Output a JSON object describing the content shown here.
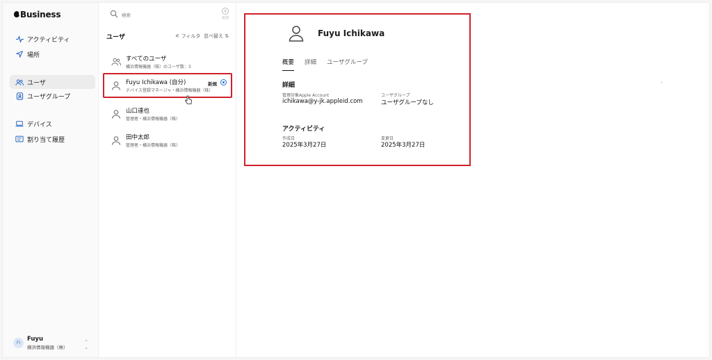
{
  "app": {
    "brand": "Business"
  },
  "sidebar": {
    "items": [
      {
        "label": "アクティビティ",
        "icon": "activity-icon"
      },
      {
        "label": "場所",
        "icon": "location-arrow-icon"
      },
      {
        "label": "ユーザ",
        "icon": "users-icon",
        "active": true
      },
      {
        "label": "ユーザグループ",
        "icon": "user-group-icon"
      },
      {
        "label": "デバイス",
        "icon": "laptop-icon"
      },
      {
        "label": "割り当て履歴",
        "icon": "history-icon"
      }
    ],
    "account": {
      "initials": "FI",
      "name": "Fuyu",
      "org": "横浜情報機器（株）"
    }
  },
  "list": {
    "search_placeholder": "検索",
    "add_label": "追加",
    "title": "ユーザ",
    "filter_label": "フィルタ",
    "sort_label": "並べ替え",
    "rows": [
      {
        "name": "すべてのユーザ",
        "sub": "横浜情報機器（株）のユーザ数：3",
        "icon": "group-icon"
      },
      {
        "name": "Fuyu Ichikawa (自分)",
        "sub": "デバイス登録マネージャ・横浜情報機器（株）",
        "badge": "新規",
        "selected": true,
        "icon": "person-icon"
      },
      {
        "name": "山口達也",
        "sub": "管理者・横浜情報機器（株）",
        "icon": "person-icon"
      },
      {
        "name": "田中太郎",
        "sub": "管理者・横浜情報機器（株）",
        "icon": "person-icon"
      }
    ]
  },
  "detail": {
    "name": "Fuyu Ichikawa",
    "tabs": [
      "概要",
      "詳細",
      "ユーザグループ"
    ],
    "active_tab": "概要",
    "details_title": "詳細",
    "managed_label": "管理対象Apple Account",
    "managed_value": "ichikawa@y-jk.appleid.com",
    "group_label": "ユーザグループ",
    "group_value": "ユーザグループなし",
    "activity_title": "アクティビティ",
    "created_label": "作成日",
    "created_value": "2025年3月27日",
    "modified_label": "変更日",
    "modified_value": "2025年3月27日"
  },
  "colors": {
    "highlight": "#d0202a",
    "accent": "#1f6fd6"
  }
}
